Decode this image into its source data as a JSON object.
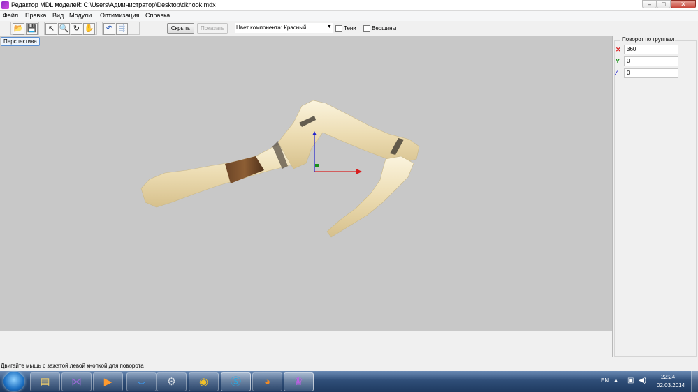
{
  "window": {
    "title": "Редактор MDL моделей: C:\\Users\\Администратор\\Desktop\\dkhook.mdx",
    "minimize_glyph": "–",
    "maximize_glyph": "□",
    "close_glyph": "✕"
  },
  "menu": [
    "Файл",
    "Правка",
    "Вид",
    "Модули",
    "Оптимизация",
    "Справка"
  ],
  "toolbar": {
    "hide_button": "Скрыть",
    "show_button": "Показать",
    "component_select": "Цвет компонента: Красный",
    "checkbox_shadow": "Тени",
    "checkbox_vertices": "Вершины"
  },
  "viewport": {
    "view_button": "Перспектива",
    "background_color": "#c8c8c8",
    "gizmo_colors": {
      "x": "#d81e1e",
      "y": "#1a8f1a",
      "z": "#2222cc"
    }
  },
  "right_panel": {
    "group_title": "Поворот по группам",
    "axes": [
      {
        "label": "X",
        "value": "360",
        "color": "#d81e1e"
      },
      {
        "label": "Y",
        "value": "0",
        "color": "#1a8f1a"
      },
      {
        "label": "Z",
        "value": "0",
        "color": "#2222cc"
      }
    ]
  },
  "status": "Двигайте мышь с зажатой левой кнопкой для поворота",
  "taskbar": {
    "tray_language": "EN",
    "time": "22:24",
    "date": "02.03.2014",
    "apps": [
      "folder-icon",
      "visual-studio-icon",
      "media-player-icon",
      "teamviewer-icon",
      "steam-icon",
      "chrome-icon",
      "skype-icon",
      "blender-icon",
      "mdl-editor-icon"
    ]
  }
}
